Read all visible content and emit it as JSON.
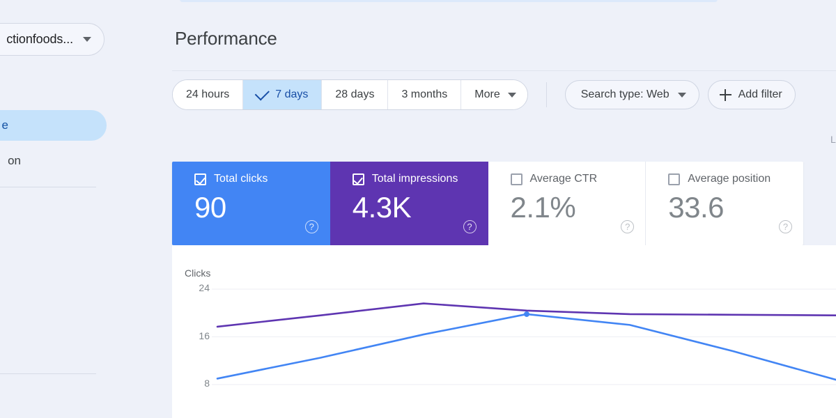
{
  "sidebar": {
    "property_selector": {
      "label": "ctionfoods...",
      "icon": "chevron-down-icon"
    },
    "items": [
      {
        "label": "e",
        "selected": true
      },
      {
        "label": "on",
        "selected": false
      }
    ]
  },
  "header": {
    "title": "Performance",
    "last_updated": "L"
  },
  "toolbar": {
    "date_ranges": [
      {
        "label": "24 hours",
        "selected": false
      },
      {
        "label": "7 days",
        "selected": true
      },
      {
        "label": "28 days",
        "selected": false
      },
      {
        "label": "3 months",
        "selected": false
      },
      {
        "label": "More",
        "selected": false,
        "icon": "chevron-down-icon"
      }
    ],
    "search_type": {
      "label": "Search type: Web",
      "icon": "chevron-down-icon"
    },
    "add_filter": {
      "label": "Add filter",
      "icon": "plus-icon"
    }
  },
  "metric_cards": [
    {
      "label": "Total clicks",
      "value": "90",
      "checked": true,
      "color": "#4285f4",
      "help": "?"
    },
    {
      "label": "Total impressions",
      "value": "4.3K",
      "checked": true,
      "color": "#5e35b1",
      "help": "?"
    },
    {
      "label": "Average CTR",
      "value": "2.1%",
      "checked": false,
      "color": "#ffffff",
      "help": "?"
    },
    {
      "label": "Average position",
      "value": "33.6",
      "checked": false,
      "color": "#ffffff",
      "help": "?"
    }
  ],
  "chart_data": {
    "type": "line",
    "title": "",
    "ylabel": "Clicks",
    "xlabel": "",
    "ylim": [
      0,
      28
    ],
    "yticks": [
      24,
      16,
      8
    ],
    "grid": true,
    "legend": "none",
    "x": [
      0,
      1,
      2,
      3,
      4,
      5,
      6
    ],
    "series": [
      {
        "name": "Clicks",
        "color": "#4285f4",
        "values": [
          9.0,
          12.5,
          16.4,
          19.8,
          18.0,
          13.6,
          8.8
        ]
      },
      {
        "name": "Impressions",
        "color": "#5e35b1",
        "values": [
          17.7,
          19.6,
          21.6,
          20.4,
          19.8,
          19.7,
          19.6
        ]
      }
    ],
    "markers": [
      {
        "series": "Clicks",
        "x": 3,
        "y": 19.8
      }
    ]
  }
}
